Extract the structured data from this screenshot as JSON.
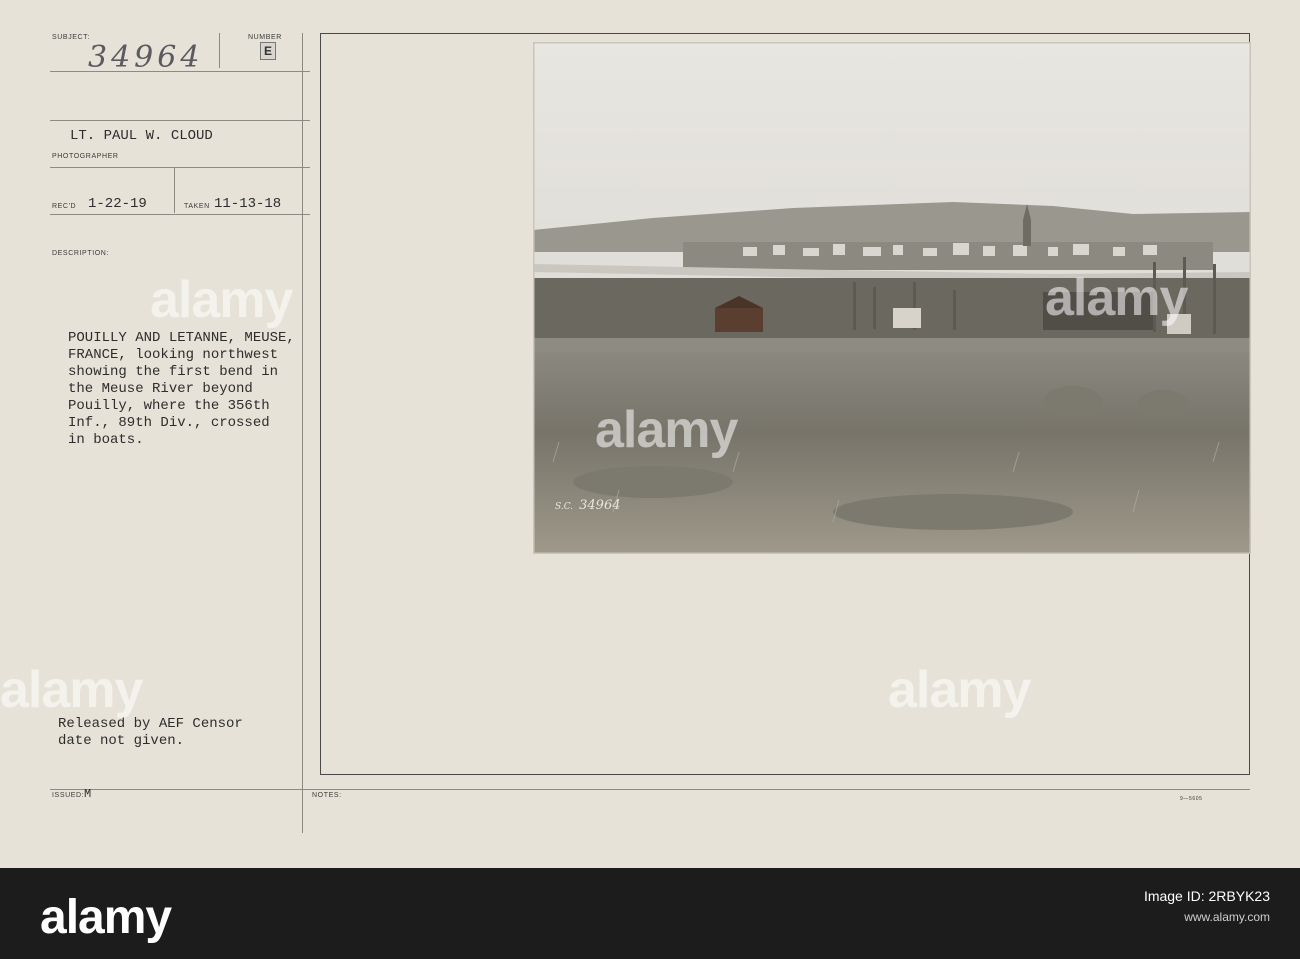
{
  "card": {
    "subject_label": "SUBJECT:",
    "number_label": "NUMBER",
    "number_stamp": "E",
    "subject_number": "34964",
    "photographer_name": "LT. PAUL W. CLOUD",
    "photographer_label": "PHOTOGRAPHER",
    "recd_label": "REC'D",
    "recd_date": "1-22-19",
    "taken_label": "TAKEN",
    "taken_date": "11-13-18",
    "description_label": "DESCRIPTION:",
    "description_lines": [
      "POUILLY AND LETANNE, MEUSE,",
      "FRANCE, looking northwest",
      "showing the first bend in",
      "the Meuse River beyond",
      "Pouilly, where the 356th",
      "Inf., 89th Div., crossed",
      "in boats."
    ],
    "release_lines": [
      "Released by AEF Censor",
      "date not given."
    ],
    "issued_label": "ISSUED:",
    "issued_value": "M",
    "notes_label": "NOTES:",
    "form_number": "9—5605",
    "photo_caption": "34964",
    "photo_caption_small": "S.C.",
    "watermark_text": "alamy"
  },
  "footer": {
    "logo_text": "alamy",
    "image_id_line": "Image ID: 2RBYK23",
    "site": "www.alamy.com"
  }
}
